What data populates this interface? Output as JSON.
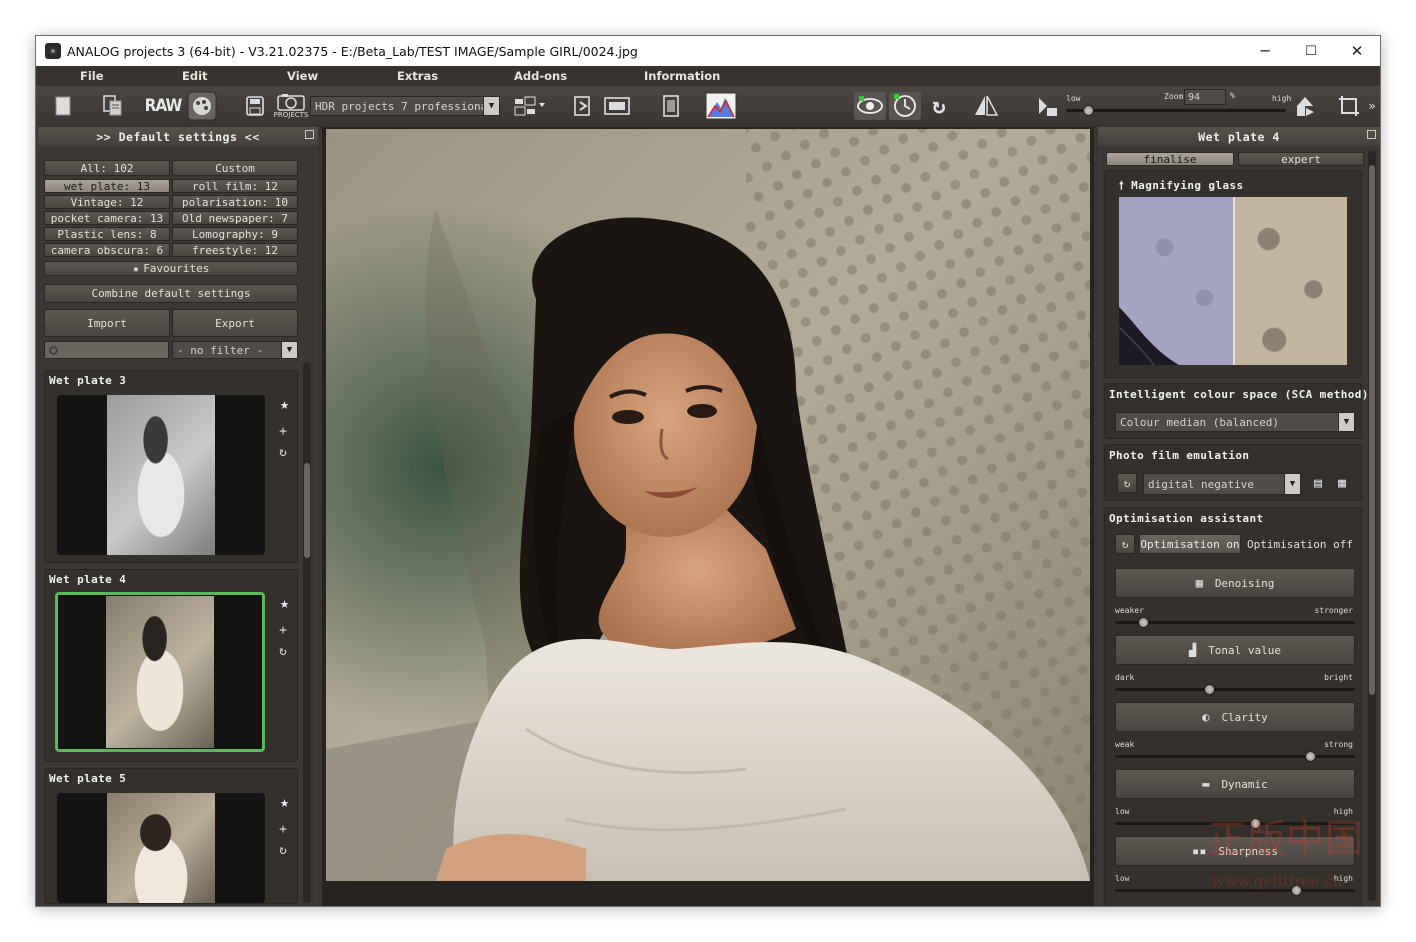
{
  "window": {
    "title": "ANALOG projects 3 (64-bit) - V3.21.02375 - E:/Beta_Lab/TEST IMAGE/Sample GIRL/0024.jpg",
    "minimize": "─",
    "maximize": "☐",
    "close": "✕"
  },
  "menu": [
    "File",
    "Edit",
    "View",
    "Extras",
    "Add-ons",
    "Information"
  ],
  "toolbar": {
    "raw_label": "RAW",
    "projects_label": "PROJECTS",
    "hdr_combo": "HDR projects 7 professional",
    "low_label": "low",
    "high_label": "high",
    "zoom_label": "Zoom",
    "zoom_value": "94",
    "zoom_unit": "%"
  },
  "left_panel": {
    "header": ">> Default settings <<",
    "categories": [
      {
        "label": "All: 102",
        "selected": false
      },
      {
        "label": "Custom",
        "selected": false
      },
      {
        "label": "wet plate: 13",
        "selected": true
      },
      {
        "label": "roll film: 12",
        "selected": false
      },
      {
        "label": "Vintage: 12",
        "selected": false
      },
      {
        "label": "polarisation: 10",
        "selected": false
      },
      {
        "label": "pocket camera: 13",
        "selected": false
      },
      {
        "label": "Old newspaper: 7",
        "selected": false
      },
      {
        "label": "Plastic lens: 8",
        "selected": false
      },
      {
        "label": "Lomography: 9",
        "selected": false
      },
      {
        "label": "camera obscura: 6",
        "selected": false
      },
      {
        "label": "freestyle: 12",
        "selected": false
      }
    ],
    "favourites": "Favourites",
    "combine": "Combine default settings",
    "import": "Import",
    "export": "Export",
    "filter": "- no filter -",
    "presets": [
      {
        "name": "Wet plate 3",
        "selected": false
      },
      {
        "name": "Wet plate 4",
        "selected": true
      },
      {
        "name": "Wet plate 5",
        "selected": false
      }
    ]
  },
  "right_panel": {
    "header": "Wet plate 4",
    "tabs": [
      {
        "label": "finalise",
        "selected": true
      },
      {
        "label": "expert",
        "selected": false
      }
    ],
    "magnifier": "Magnifying glass",
    "colour_space_title": "Intelligent colour space (SCA method)",
    "colour_space_value": "Colour median (balanced)",
    "film_title": "Photo film emulation",
    "film_value": "digital negative",
    "optim_title": "Optimisation assistant",
    "optim_on": "Optimisation on",
    "optim_off": "Optimisation off",
    "sliders": [
      {
        "label": "Denoising",
        "left": "weaker",
        "right": "stronger",
        "value": 0.1
      },
      {
        "label": "Tonal value",
        "left": "dark",
        "right": "bright",
        "value": 0.39
      },
      {
        "label": "Clarity",
        "left": "weak",
        "right": "strong",
        "value": 0.83
      },
      {
        "label": "Dynamic",
        "left": "low",
        "right": "high",
        "value": 0.59
      },
      {
        "label": "Sharpness",
        "left": "low",
        "right": "high",
        "value": 0.77
      }
    ]
  },
  "zoom_slider_value": 0.08,
  "accent_green": "#5cb85c",
  "watermark": "正版中国",
  "watermark_url": "www.getitfree.cn"
}
